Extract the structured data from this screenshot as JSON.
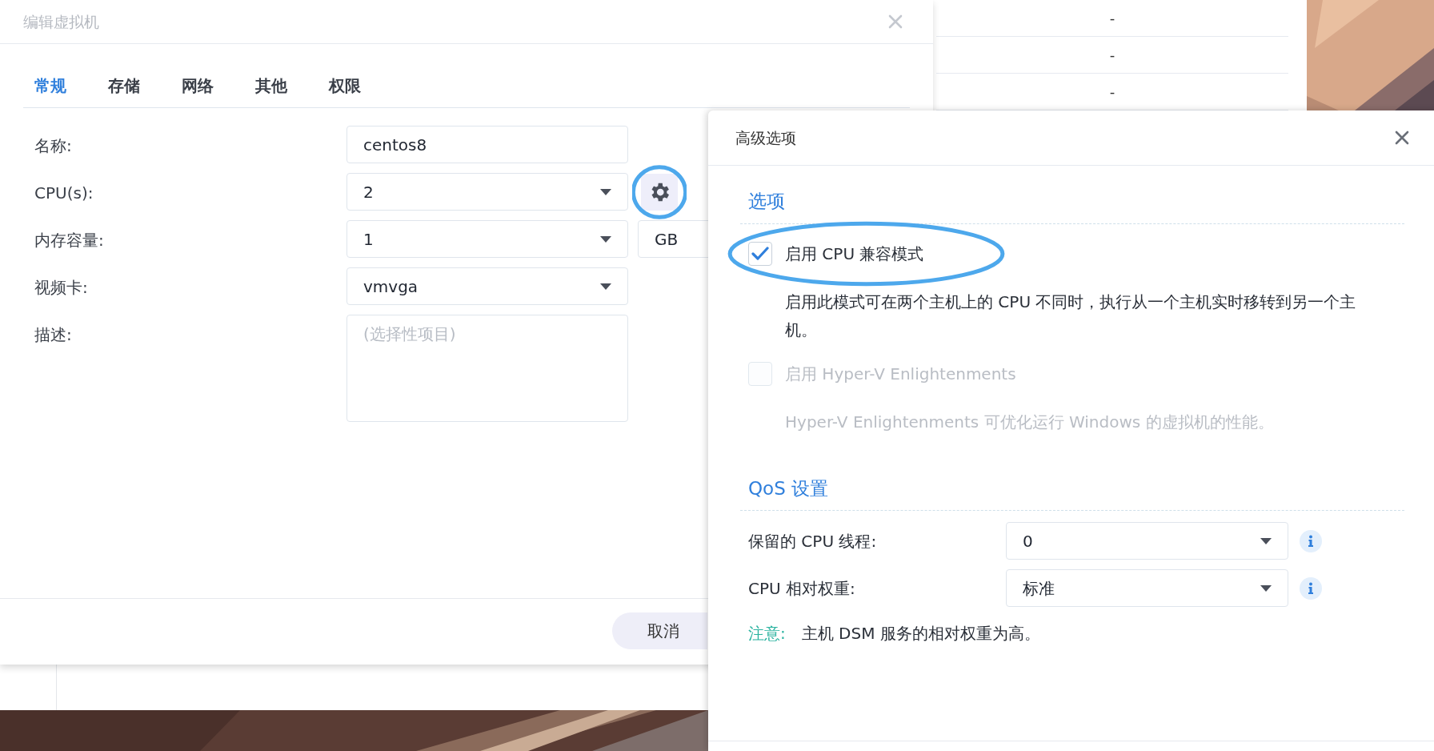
{
  "background_table": {
    "rows": [
      {
        "cell": "-"
      },
      {
        "cell": "-"
      },
      {
        "cell": "-"
      }
    ]
  },
  "main_dialog": {
    "title": "编辑虚拟机",
    "tabs": [
      {
        "label": "常规",
        "selected": true
      },
      {
        "label": "存储",
        "selected": false
      },
      {
        "label": "网络",
        "selected": false
      },
      {
        "label": "其他",
        "selected": false
      },
      {
        "label": "权限",
        "selected": false
      }
    ],
    "fields": [
      {
        "label": "名称:",
        "kind": "text",
        "value": "centos8"
      },
      {
        "label": "CPU(s):",
        "kind": "select",
        "value": "2",
        "settings_button": true,
        "highlighted": true
      },
      {
        "label": "内存容量:",
        "kind": "select",
        "value": "1",
        "unit": "GB"
      },
      {
        "label": "视频卡:",
        "kind": "select",
        "value": "vmvga"
      },
      {
        "label": "描述:",
        "kind": "textarea",
        "placeholder": "(选择性项目)"
      }
    ],
    "buttons": [
      {
        "label": "取消"
      }
    ]
  },
  "advanced_dialog": {
    "title": "高级选项",
    "options_section": {
      "title": "选项",
      "options": [
        {
          "label": "启用 CPU 兼容模式",
          "checked": true,
          "disabled": false,
          "highlighted": true,
          "description": "启用此模式可在两个主机上的 CPU 不同时，执行从一个主机实时移转到另一个主机。"
        },
        {
          "label": "启用 Hyper-V Enlightenments",
          "checked": false,
          "disabled": true,
          "highlighted": false,
          "description": "Hyper-V Enlightenments 可优化运行 Windows 的虚拟机的性能。"
        }
      ]
    },
    "qos_section": {
      "title": "QoS 设置",
      "fields": [
        {
          "label": "保留的 CPU 线程:",
          "value": "0"
        },
        {
          "label": "CPU 相对权重:",
          "value": "标准"
        }
      ],
      "note": {
        "label": "注意:",
        "text": "主机 DSM 服务的相对权重为高。"
      }
    }
  }
}
